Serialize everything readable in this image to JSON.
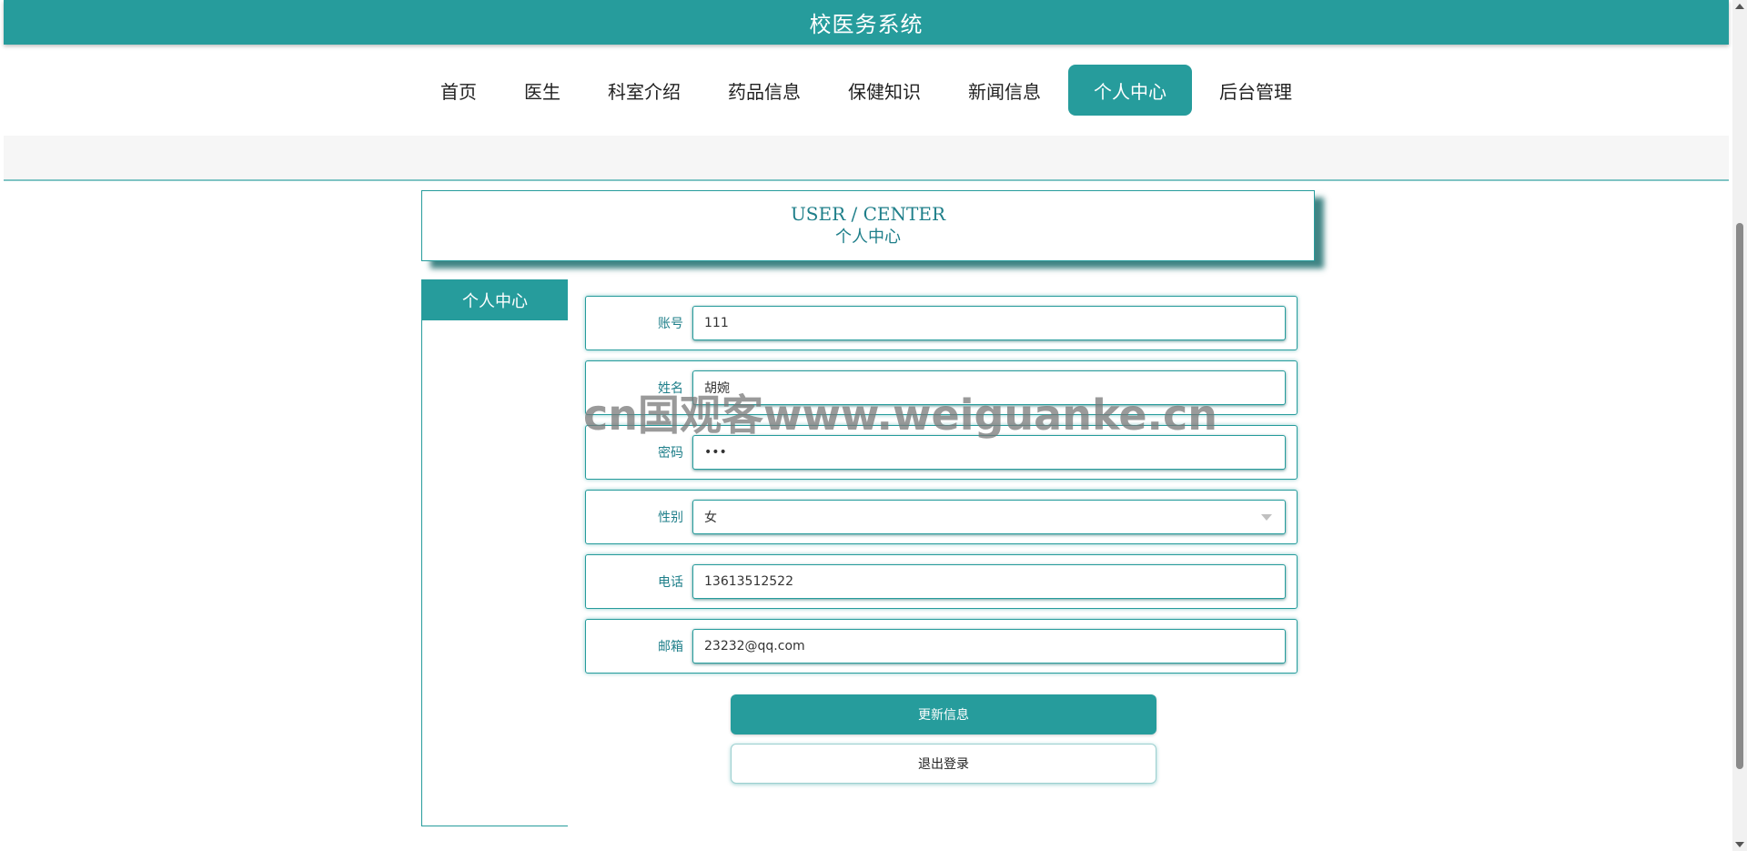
{
  "app_title": "校医务系统",
  "nav": {
    "items": [
      {
        "label": "首页"
      },
      {
        "label": "医生"
      },
      {
        "label": "科室介绍"
      },
      {
        "label": "药品信息"
      },
      {
        "label": "保健知识"
      },
      {
        "label": "新闻信息"
      },
      {
        "label": "个人中心"
      },
      {
        "label": "后台管理"
      }
    ],
    "active": "个人中心"
  },
  "header": {
    "title_en": "USER / CENTER",
    "title_cn": "个人中心"
  },
  "sidebar": {
    "title": "个人中心"
  },
  "form": {
    "fields": [
      {
        "label": "账号",
        "value": "111"
      },
      {
        "label": "姓名",
        "value": "胡婉"
      },
      {
        "label": "密码",
        "value": "•••"
      },
      {
        "label": "性别",
        "value": "女"
      },
      {
        "label": "电话",
        "value": "13613512522"
      },
      {
        "label": "邮箱",
        "value": "23232@qq.com"
      }
    ],
    "update_button": "更新信息",
    "logout_button": "退出登录"
  },
  "watermark": "cn国观客www.weiguanke.cn",
  "colors": {
    "accent": "#269c9c",
    "text_accent": "#1f7f8a"
  }
}
